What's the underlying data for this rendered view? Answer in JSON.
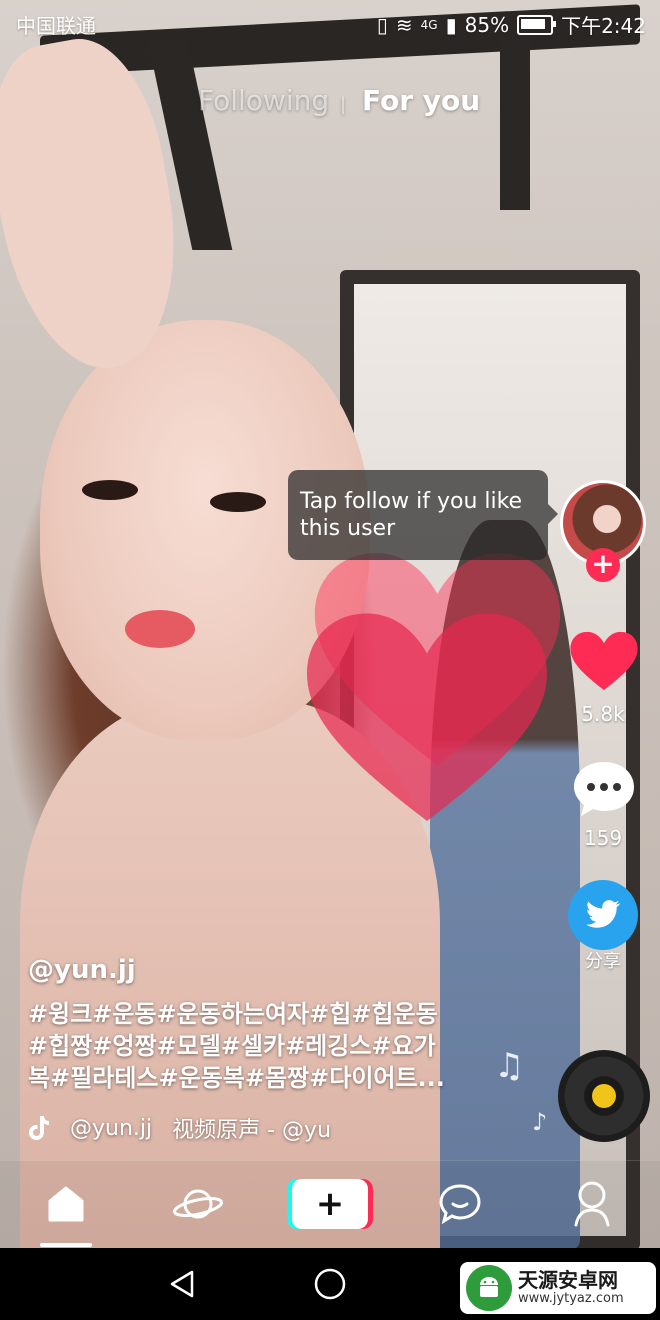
{
  "status_bar": {
    "carrier": "中国联通",
    "network": "4G",
    "battery": "85%",
    "battery_level": 0.85,
    "time": "下午2:42"
  },
  "top_tabs": {
    "following": "Following",
    "separator": "|",
    "for_you": "For you"
  },
  "tooltip": {
    "text": "Tap follow if you like this user"
  },
  "right_rail": {
    "like_count": "5.8k",
    "comment_count": "159",
    "share_label": "分享",
    "like_color": "#fe2c55",
    "share_color": "#2aa3ef"
  },
  "post": {
    "username": "@yun.jj",
    "caption_lines": [
      "#윙크#운동#운동하는여자#힙#힙운동",
      "#힙짱#엉짱#모델#셀카#레깅스#요가",
      "복#필라테스#운동복#몸짱#다이어트..."
    ],
    "music_user": "@yun.jj",
    "music_text": "视频原声 - @yu"
  },
  "bottom_nav": {
    "items": [
      "home-icon",
      "discover-icon",
      "create-icon",
      "inbox-icon",
      "profile-icon"
    ]
  },
  "watermark": {
    "title": "天源安卓网",
    "url": "www.jytyaz.com"
  }
}
